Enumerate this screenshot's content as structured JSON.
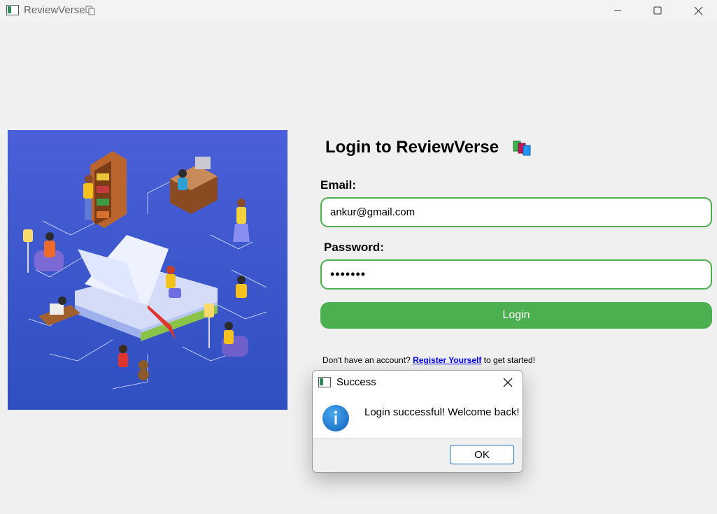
{
  "window": {
    "title": "ReviewVerse",
    "icons": {
      "app": "app-window-icon",
      "copy": "copy-icon",
      "minimize": "minimize-icon",
      "maximize": "maximize-icon",
      "close": "close-icon"
    }
  },
  "hero": {
    "illustration": "isometric-reading-library-illustration"
  },
  "login": {
    "title": "Login to ReviewVerse",
    "title_icon": "books-icon",
    "email_label": "Email:",
    "email_value": "ankur@gmail.com",
    "password_label": "Password:",
    "password_value": "•••••••",
    "login_button": "Login",
    "register_prefix": "Don't have an account?",
    "register_link": "Register Yourself",
    "register_suffix": "to get started!"
  },
  "dialog": {
    "title": "Success",
    "message": "Login successful! Welcome back!",
    "ok_button": "OK",
    "icon": "info-icon"
  },
  "colors": {
    "accent_green": "#4caf50",
    "link_blue": "#0000ee",
    "info_blue": "#1e7fd1",
    "hero_bg_top": "#4a5fd8",
    "hero_bg_bottom": "#2f4fc0"
  }
}
